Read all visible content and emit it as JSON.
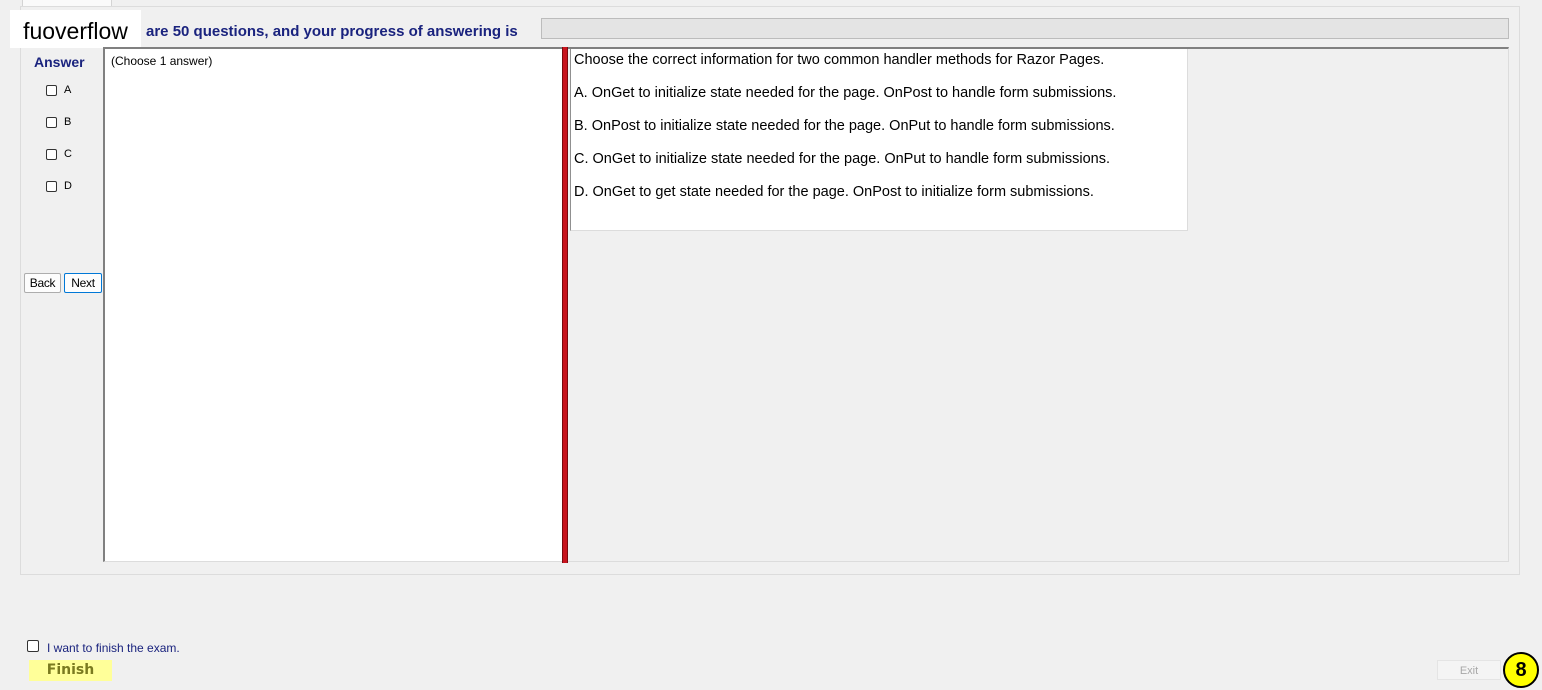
{
  "header": {
    "logo_text": "fuoverflow",
    "progress_text": "are 50 questions, and your progress of answering is",
    "progress_percent": 0
  },
  "answer_panel": {
    "title": "Answer",
    "options": [
      "A",
      "B",
      "C",
      "D"
    ],
    "back_label": "Back",
    "next_label": "Next"
  },
  "answer_area": {
    "instruction": "(Choose 1 answer)"
  },
  "question": {
    "stem": "Choose the correct information for two common handler methods for Razor Pages.",
    "choices": [
      "A.  OnGet to initialize state needed for the page. OnPost to handle form submissions.",
      "B.  OnPost to initialize state needed for the page. OnPut to handle form submissions.",
      "C.  OnGet to initialize state needed for the page. OnPut to handle form submissions.",
      "D.  OnGet to get state needed for the page. OnPost to initialize form submissions."
    ]
  },
  "footer": {
    "finish_checkbox_label": "I want to finish the exam.",
    "finish_label": "Finish",
    "exit_label": "Exit",
    "question_number": "8"
  },
  "colors": {
    "accent_text": "#1a237e",
    "splitter": "#c8141e",
    "finish_bg": "#ffff99",
    "badge_bg": "#ffff00"
  }
}
